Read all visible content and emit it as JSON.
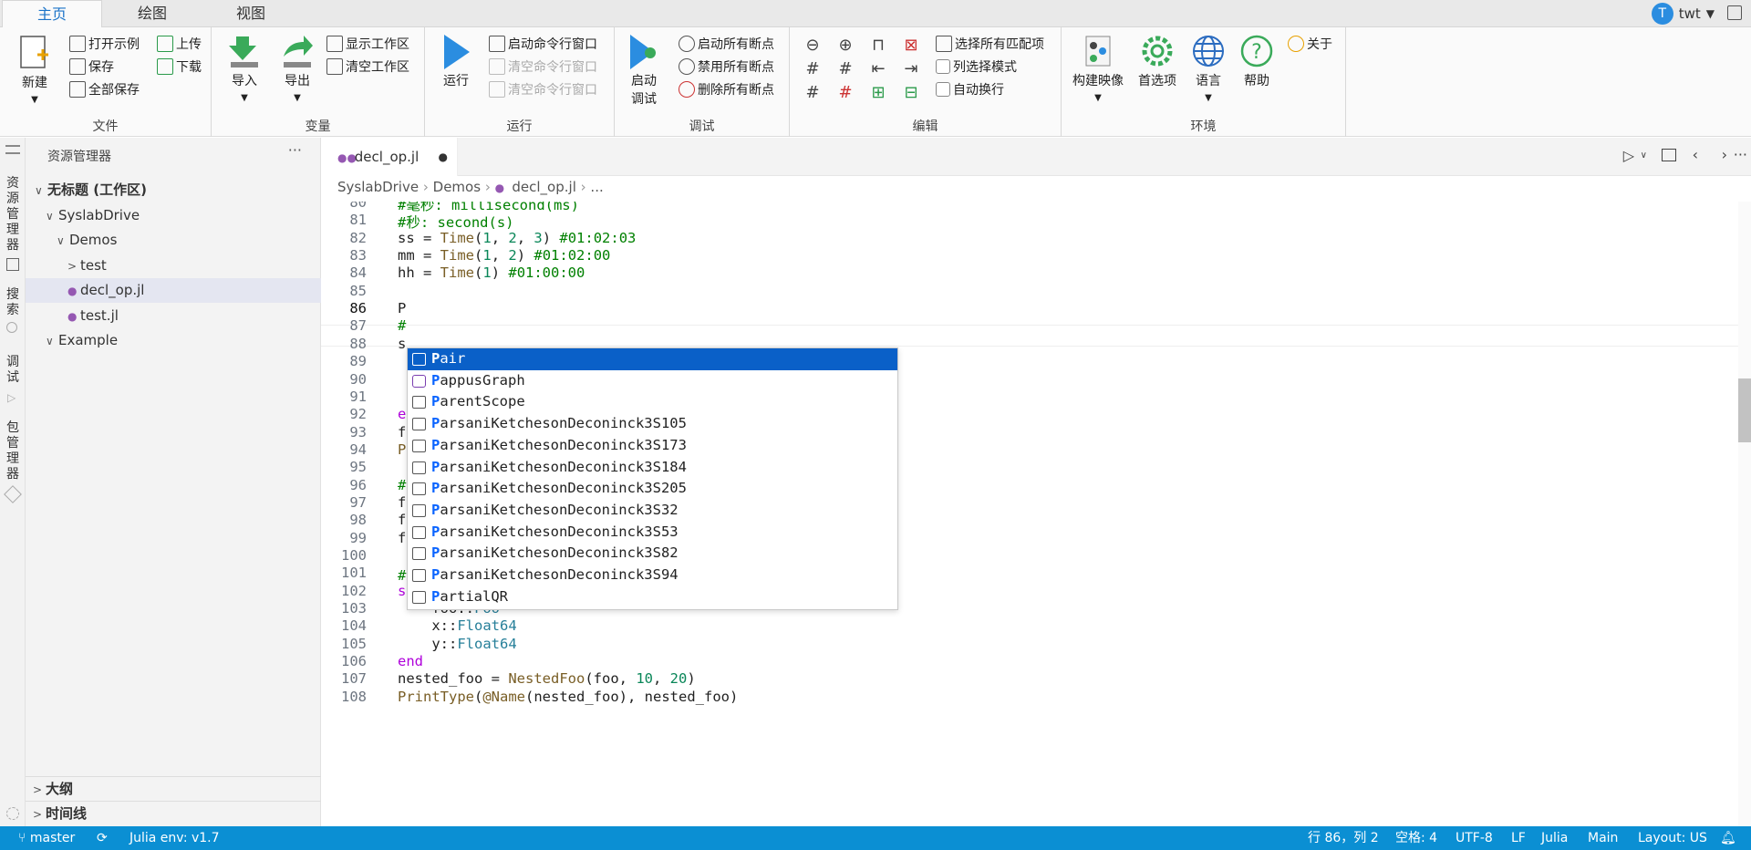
{
  "ribbon_tabs": [
    "主页",
    "绘图",
    "视图"
  ],
  "user": {
    "initial": "T",
    "name": "twt"
  },
  "ribbon": {
    "file": {
      "label": "文件",
      "new": "新建",
      "open_example": "打开示例",
      "save": "保存",
      "save_all": "全部保存",
      "upload": "上传",
      "download": "下载"
    },
    "vars": {
      "label": "变量",
      "import": "导入",
      "export": "导出",
      "show_ws": "显示工作区",
      "clear_ws": "清空工作区"
    },
    "run": {
      "label": "运行",
      "run": "运行",
      "start_cmd": "启动命令行窗口",
      "clear_cmd1": "清空命令行窗口",
      "clear_cmd2": "清空命令行窗口"
    },
    "debug": {
      "label": "调试",
      "start": "启动\n调试",
      "start_l1": "启动",
      "start_l2": "调试",
      "enable_bp": "启动所有断点",
      "disable_bp": "禁用所有断点",
      "delete_bp": "删除所有断点"
    },
    "edit": {
      "label": "编辑",
      "select_all_match": "选择所有匹配项",
      "column_mode": "列选择模式",
      "auto_wrap": "自动换行"
    },
    "env": {
      "label": "环境",
      "build_image": "构建映像",
      "prefs": "首选项",
      "language": "语言",
      "help": "帮助",
      "about": "关于"
    }
  },
  "activity": {
    "explorer": "资源管理器",
    "search": "搜索",
    "debug": "调试",
    "packages": "包管理器"
  },
  "sidebar": {
    "title": "资源管理器",
    "items": [
      {
        "label": "无标题 (工作区)",
        "level": 0,
        "chev": "∨",
        "bold": true
      },
      {
        "label": "SyslabDrive",
        "level": 1,
        "chev": "∨"
      },
      {
        "label": "Demos",
        "level": 2,
        "chev": "∨"
      },
      {
        "label": "test",
        "level": 3,
        "chev": ">"
      },
      {
        "label": "decl_op.jl",
        "level": 3,
        "file": true,
        "selected": true
      },
      {
        "label": "test.jl",
        "level": 3,
        "file": true
      },
      {
        "label": "Example",
        "level": 1,
        "chev": "∨"
      }
    ],
    "outline": "大纲",
    "timeline": "时间线"
  },
  "editor": {
    "tab": "decl_op.jl",
    "breadcrumb": [
      "SyslabDrive",
      "Demos",
      "decl_op.jl",
      "..."
    ]
  },
  "code_lines": [
    {
      "n": "80",
      "html": "<span class='c'>#毫秒: millisecond(ms)</span>"
    },
    {
      "n": "81",
      "html": "<span class='c'>#秒: second(s)</span>"
    },
    {
      "n": "82",
      "html": "ss = <span class='f'>Time</span>(<span class='n'>1</span>, <span class='n'>2</span>, <span class='n'>3</span>) <span class='c'>#01:02:03</span>"
    },
    {
      "n": "83",
      "html": "mm = <span class='f'>Time</span>(<span class='n'>1</span>, <span class='n'>2</span>) <span class='c'>#01:02:00</span>"
    },
    {
      "n": "84",
      "html": "hh = <span class='f'>Time</span>(<span class='n'>1</span>) <span class='c'>#01:00:00</span>"
    },
    {
      "n": "85",
      "html": ""
    },
    {
      "n": "86",
      "html": "P"
    },
    {
      "n": "87",
      "html": "<span class='c'>#</span>"
    },
    {
      "n": "88",
      "html": "s"
    },
    {
      "n": "89",
      "html": ""
    },
    {
      "n": "90",
      "html": ""
    },
    {
      "n": "91",
      "html": ""
    },
    {
      "n": "92",
      "html": "<span class='k'>e</span>"
    },
    {
      "n": "93",
      "html": "f"
    },
    {
      "n": "94",
      "html": "<span class='f'>P</span>"
    },
    {
      "n": "95",
      "html": ""
    },
    {
      "n": "96",
      "html": "<span class='c'>#</span>"
    },
    {
      "n": "97",
      "html": "f"
    },
    {
      "n": "98",
      "html": "f"
    },
    {
      "n": "99",
      "html": "foo_narray = <span class='f'>fill</span>(foo, <span class='n'>2</span>, <span class='n'>2</span>, <span class='n'>2</span>)"
    },
    {
      "n": "100",
      "html": ""
    },
    {
      "n": "101",
      "html": "<span class='c'>#结构体嵌套</span>"
    },
    {
      "n": "102",
      "html": "<span class='k'>struct</span> NestedFoo"
    },
    {
      "n": "103",
      "html": "    foo::<span class='t'>Foo</span>"
    },
    {
      "n": "104",
      "html": "    x::<span class='t'>Float64</span>"
    },
    {
      "n": "105",
      "html": "    y::<span class='t'>Float64</span>"
    },
    {
      "n": "106",
      "html": "<span class='k'>end</span>"
    },
    {
      "n": "107",
      "html": "nested_foo = <span class='f'>NestedFoo</span>(foo, <span class='n'>10</span>, <span class='n'>20</span>)"
    },
    {
      "n": "108",
      "html": "<span class='f'>PrintType</span>(<span class='f'>@Name</span>(nested_foo), nested_foo)"
    }
  ],
  "suggestions": [
    "Pair",
    "PappusGraph",
    "ParentScope",
    "ParsaniKetchesonDeconinck3S105",
    "ParsaniKetchesonDeconinck3S173",
    "ParsaniKetchesonDeconinck3S184",
    "ParsaniKetchesonDeconinck3S205",
    "ParsaniKetchesonDeconinck3S32",
    "ParsaniKetchesonDeconinck3S53",
    "ParsaniKetchesonDeconinck3S82",
    "ParsaniKetchesonDeconinck3S94",
    "PartialQR"
  ],
  "status": {
    "branch": "master",
    "julia_env": "Julia env: v1.7",
    "position": "行 86，列 2",
    "spaces": "空格: 4",
    "encoding": "UTF-8",
    "eol": "LF",
    "language": "Julia",
    "env": "Main",
    "layout": "Layout: US"
  },
  "colors": {
    "accent": "#0b8fd3",
    "selection": "#0a60c8",
    "julia": "#9558b2"
  }
}
